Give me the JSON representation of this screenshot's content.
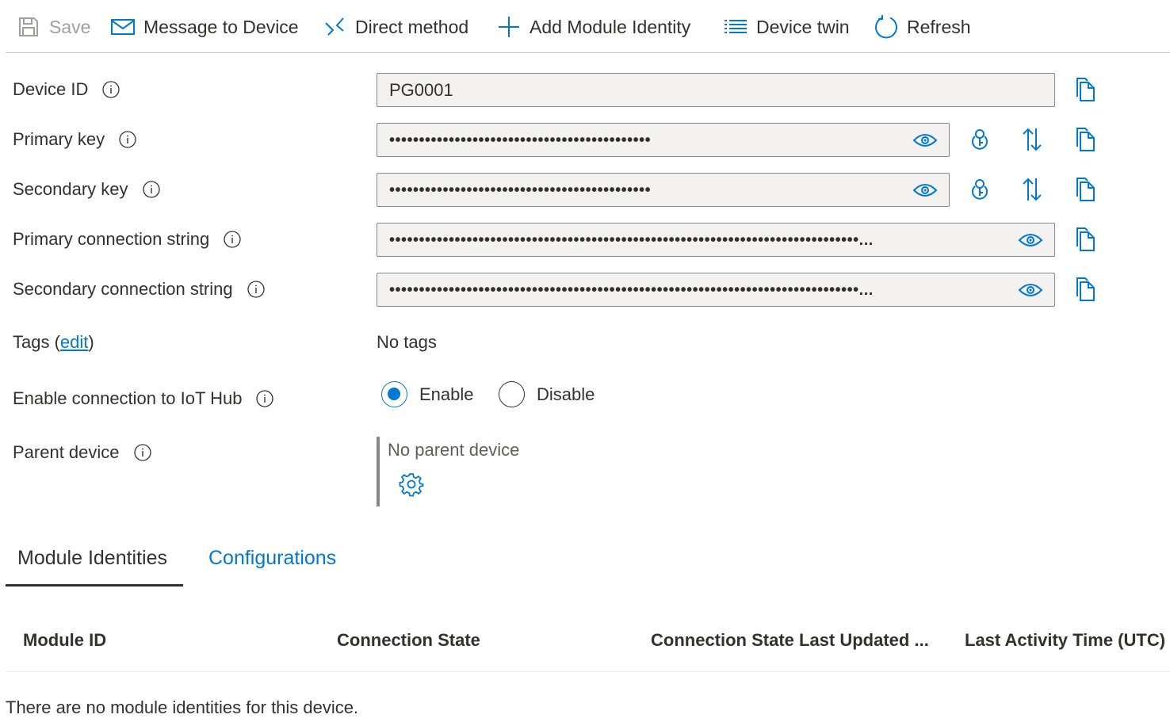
{
  "toolbar": {
    "save": "Save",
    "message_to_device": "Message to Device",
    "direct_method": "Direct method",
    "add_module_identity": "Add Module Identity",
    "device_twin": "Device twin",
    "refresh": "Refresh"
  },
  "form": {
    "device_id": {
      "label": "Device ID",
      "value": "PG0001"
    },
    "primary_key": {
      "label": "Primary key",
      "value": "••••••••••••••••••••••••••••••••••••••••••••"
    },
    "secondary_key": {
      "label": "Secondary key",
      "value": "••••••••••••••••••••••••••••••••••••••••••••"
    },
    "primary_connection_string": {
      "label": "Primary connection string",
      "value": "•••••••••••••••••••••••••••••••••••••••••••••••••••••••••••••••••••••••••••••••..."
    },
    "secondary_connection_string": {
      "label": "Secondary connection string",
      "value": "•••••••••••••••••••••••••••••••••••••••••••••••••••••••••••••••••••••••••••••••..."
    },
    "tags": {
      "label_prefix": "Tags (",
      "edit_link": "edit",
      "label_suffix": ")",
      "value": "No tags"
    },
    "enable_connection": {
      "label": "Enable connection to IoT Hub",
      "enable": "Enable",
      "disable": "Disable",
      "selected": "Enable"
    },
    "parent_device": {
      "label": "Parent device",
      "value": "No parent device"
    }
  },
  "tabs": [
    {
      "label": "Module Identities",
      "active": true
    },
    {
      "label": "Configurations",
      "active": false
    }
  ],
  "table": {
    "columns": [
      "Module ID",
      "Connection State",
      "Connection State Last Updated ...",
      "Last Activity Time (UTC)"
    ],
    "empty_message": "There are no module identities for this device."
  },
  "colors": {
    "accent": "#0078d4",
    "text": "#323130",
    "disabled": "#a19f9d",
    "field_bg": "#f3f2f1"
  }
}
